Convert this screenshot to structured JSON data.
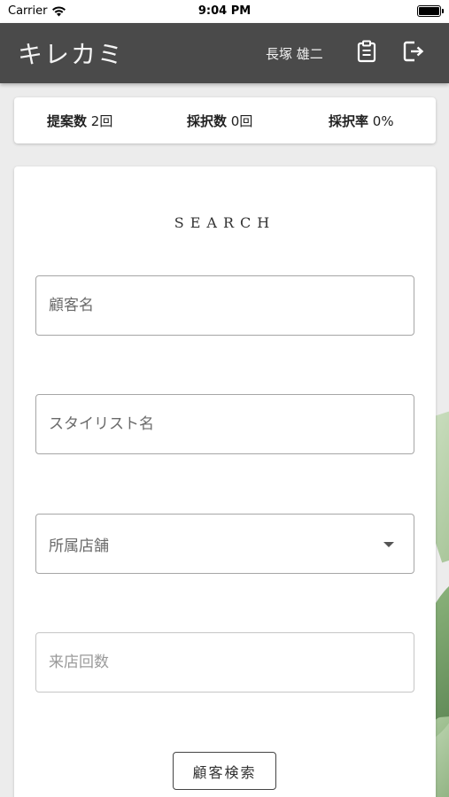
{
  "status_bar": {
    "carrier": "Carrier",
    "time": "9:04 PM",
    "icons": [
      "wifi-icon",
      "battery-icon"
    ]
  },
  "header": {
    "app_title": "キレカミ",
    "user_name": "長塚 雄二",
    "buttons": [
      "clipboard-icon",
      "logout-icon"
    ],
    "background_color": "#4a4a4a"
  },
  "stats": {
    "proposals_label": "提案数",
    "proposals_value": "2回",
    "adopted_label": "採択数",
    "adopted_value": "0回",
    "adoption_rate_label": "採択率",
    "adoption_rate_value": "0%"
  },
  "search": {
    "title": "SEARCH",
    "customer_name_placeholder": "顧客名",
    "stylist_name_placeholder": "スタイリスト名",
    "store_select_placeholder": "所属店舗",
    "visit_count_placeholder": "来店回数",
    "submit_label": "顧客検索"
  }
}
